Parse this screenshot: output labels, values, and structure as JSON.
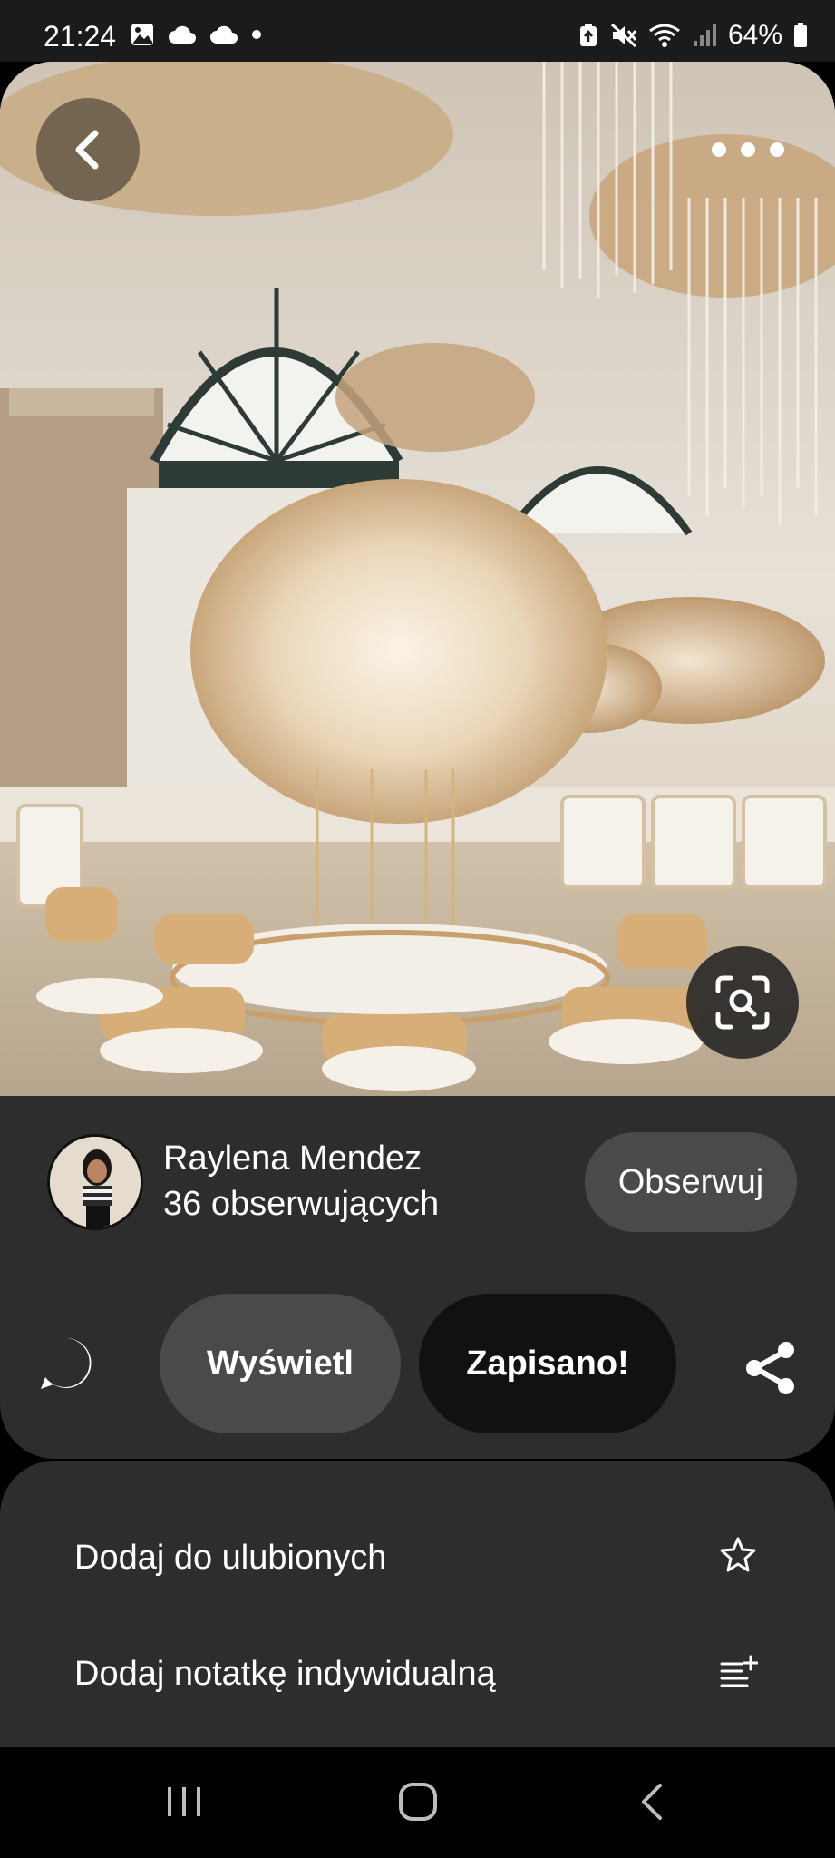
{
  "status_bar": {
    "time": "21:24",
    "battery": "64%",
    "left_icons": [
      "image-icon",
      "cloud-icon",
      "cloud-icon",
      "dot-icon"
    ],
    "right_icons": [
      "recycle-icon",
      "mute-icon",
      "wifi-icon",
      "signal-icon",
      "battery-icon"
    ]
  },
  "pin": {
    "image_description_icon": "wedding-venue-photo",
    "back_icon": "chevron-left-icon",
    "more_icon": "more-horizontal-icon",
    "lens_icon": "visual-search-icon"
  },
  "creator": {
    "name": "Raylena Mendez",
    "followers": "36 obserwujących",
    "follow_label": "Obserwuj"
  },
  "actions": {
    "comment_icon": "comment-heart-icon",
    "view_label": "Wyświetl",
    "saved_label": "Zapisano!",
    "share_icon": "share-icon"
  },
  "menu": {
    "items": [
      {
        "label": "Dodaj do ulubionych",
        "icon": "star-icon"
      },
      {
        "label": "Dodaj notatkę indywidualną",
        "icon": "add-note-icon"
      }
    ]
  },
  "nav": {
    "buttons": [
      "recents-icon",
      "home-icon",
      "back-icon"
    ]
  },
  "colors": {
    "background": "#000000",
    "card": "#2d2d2d",
    "button_gray": "#4a4a4a",
    "button_dark": "#111111",
    "text": "#ffffff"
  }
}
